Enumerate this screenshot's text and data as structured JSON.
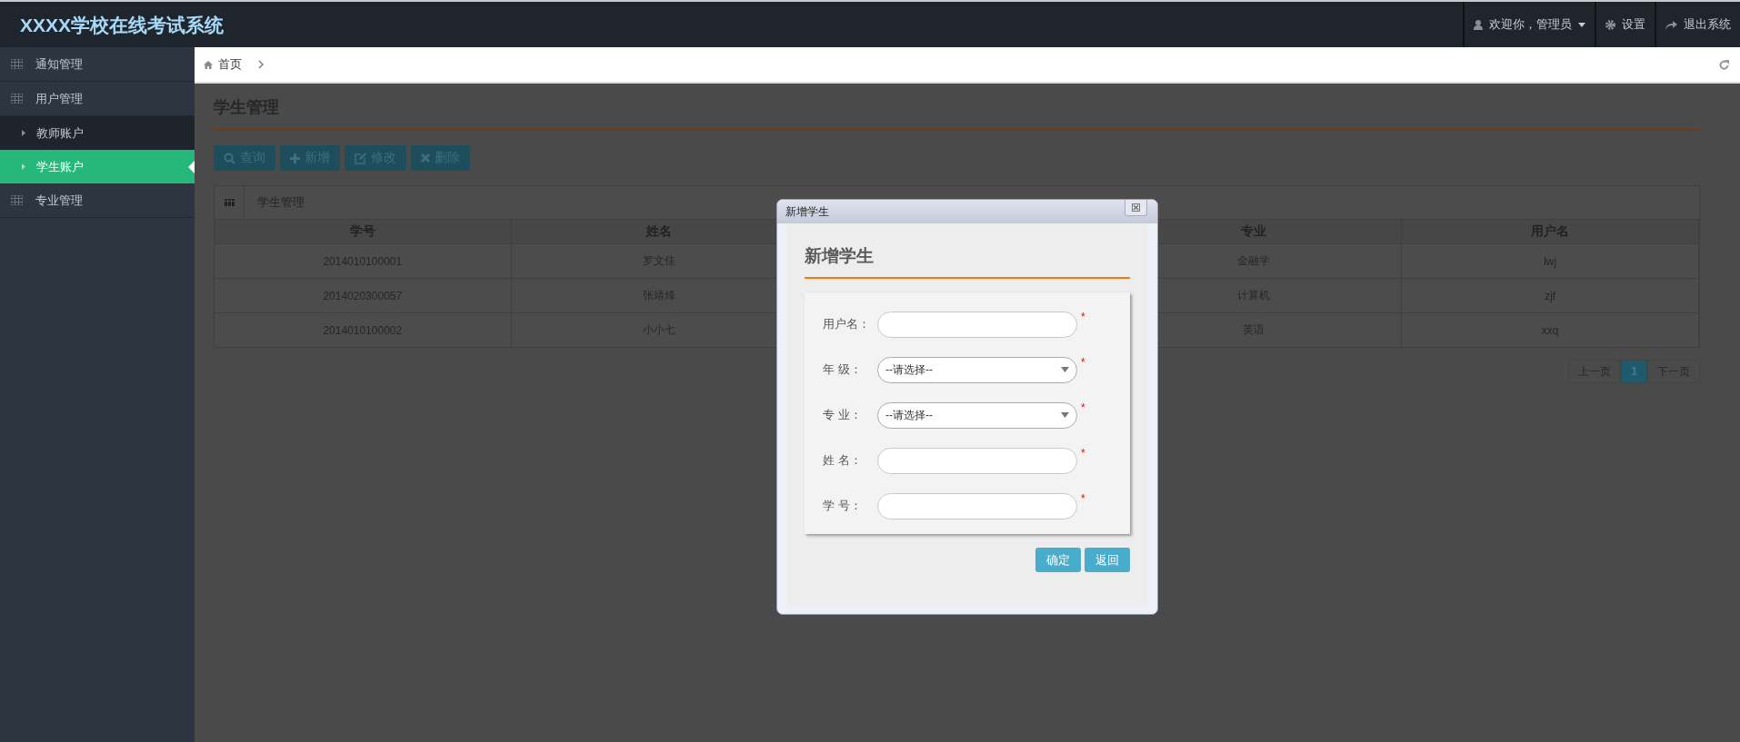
{
  "header": {
    "title": "XXXX学校在线考试系统",
    "user_menu": "欢迎你，管理员",
    "settings": "设置",
    "logout": "退出系统"
  },
  "sidebar": {
    "items": [
      {
        "label": "通知管理"
      },
      {
        "label": "用户管理",
        "children": [
          {
            "label": "教师账户",
            "selected": false
          },
          {
            "label": "学生账户",
            "selected": true
          }
        ]
      },
      {
        "label": "专业管理"
      }
    ]
  },
  "breadcrumb": {
    "home": "首页"
  },
  "page": {
    "title": "学生管理",
    "toolbar": [
      {
        "label": "查询",
        "kind": "search"
      },
      {
        "label": "新增",
        "kind": "add"
      },
      {
        "label": "修改",
        "kind": "edit"
      },
      {
        "label": "删除",
        "kind": "delete"
      }
    ]
  },
  "table": {
    "title": "学生管理",
    "columns": [
      {
        "label": "学号"
      },
      {
        "label": "姓名"
      },
      null,
      {
        "label": "专业"
      },
      {
        "label": "用户名"
      }
    ],
    "rows": [
      [
        "2014010100001",
        "罗文佳",
        null,
        "金融学",
        "lwj"
      ],
      [
        "2014020300057",
        "张靖烽",
        null,
        "计算机",
        "zjf"
      ],
      [
        "2014010100002",
        "小小七",
        null,
        "英语",
        "xxq"
      ]
    ]
  },
  "pagination": [
    {
      "label": "上一页",
      "selected": false
    },
    {
      "label": "1",
      "selected": true
    },
    {
      "label": "下一页",
      "selected": false
    }
  ],
  "dialog": {
    "title": "新增学生",
    "heading": "新增学生",
    "fields": [
      {
        "label": "用户名：",
        "kind": "text",
        "marker": "*"
      },
      {
        "label": "年 级：",
        "kind": "select",
        "value": "--请选择--",
        "marker": "*"
      },
      {
        "label": "专 业：",
        "kind": "select",
        "value": "--请选择--",
        "marker": "*"
      },
      {
        "label": "姓 名：",
        "kind": "text",
        "marker": "*"
      },
      {
        "label": "学 号：",
        "kind": "text",
        "marker": "*"
      }
    ],
    "buttons": [
      "确定",
      "返回"
    ]
  }
}
